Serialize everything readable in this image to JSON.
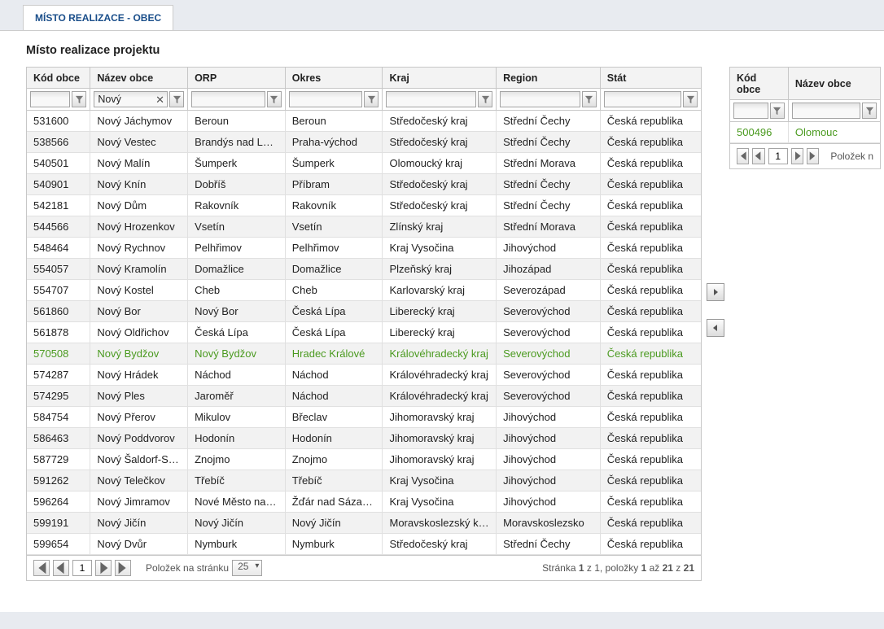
{
  "tab_label": "MÍSTO REALIZACE - OBEC",
  "section_title": "Místo realizace projektu",
  "left_grid": {
    "headers": [
      "Kód obce",
      "Název obce",
      "ORP",
      "Okres",
      "Kraj",
      "Region",
      "Stát"
    ],
    "filter_values": [
      "",
      "Nový",
      "",
      "",
      "",
      "",
      ""
    ],
    "highlight_index": 12,
    "rows": [
      [
        "531600",
        "Nový Jáchymov",
        "Beroun",
        "Beroun",
        "Středočeský kraj",
        "Střední Čechy",
        "Česká republika"
      ],
      [
        "538566",
        "Nový Vestec",
        "Brandýs nad Lab...",
        "Praha-východ",
        "Středočeský kraj",
        "Střední Čechy",
        "Česká republika"
      ],
      [
        "540501",
        "Nový Malín",
        "Šumperk",
        "Šumperk",
        "Olomoucký kraj",
        "Střední Morava",
        "Česká republika"
      ],
      [
        "540901",
        "Nový Knín",
        "Dobříš",
        "Příbram",
        "Středočeský kraj",
        "Střední Čechy",
        "Česká republika"
      ],
      [
        "542181",
        "Nový Dům",
        "Rakovník",
        "Rakovník",
        "Středočeský kraj",
        "Střední Čechy",
        "Česká republika"
      ],
      [
        "544566",
        "Nový Hrozenkov",
        "Vsetín",
        "Vsetín",
        "Zlínský kraj",
        "Střední Morava",
        "Česká republika"
      ],
      [
        "548464",
        "Nový Rychnov",
        "Pelhřimov",
        "Pelhřimov",
        "Kraj Vysočina",
        "Jihovýchod",
        "Česká republika"
      ],
      [
        "554057",
        "Nový Kramolín",
        "Domažlice",
        "Domažlice",
        "Plzeňský kraj",
        "Jihozápad",
        "Česká republika"
      ],
      [
        "554707",
        "Nový Kostel",
        "Cheb",
        "Cheb",
        "Karlovarský kraj",
        "Severozápad",
        "Česká republika"
      ],
      [
        "561860",
        "Nový Bor",
        "Nový Bor",
        "Česká Lípa",
        "Liberecký kraj",
        "Severovýchod",
        "Česká republika"
      ],
      [
        "561878",
        "Nový Oldřichov",
        "Česká Lípa",
        "Česká Lípa",
        "Liberecký kraj",
        "Severovýchod",
        "Česká republika"
      ],
      [
        "570508",
        "Nový Bydžov",
        "Nový Bydžov",
        "Hradec Králové",
        "Královéhradecký kraj",
        "Severovýchod",
        "Česká republika"
      ],
      [
        "574287",
        "Nový Hrádek",
        "Náchod",
        "Náchod",
        "Královéhradecký kraj",
        "Severovýchod",
        "Česká republika"
      ],
      [
        "574295",
        "Nový Ples",
        "Jaroměř",
        "Náchod",
        "Královéhradecký kraj",
        "Severovýchod",
        "Česká republika"
      ],
      [
        "584754",
        "Nový Přerov",
        "Mikulov",
        "Břeclav",
        "Jihomoravský kraj",
        "Jihovýchod",
        "Česká republika"
      ],
      [
        "586463",
        "Nový Poddvorov",
        "Hodonín",
        "Hodonín",
        "Jihomoravský kraj",
        "Jihovýchod",
        "Česká republika"
      ],
      [
        "587729",
        "Nový Šaldorf-Sed...",
        "Znojmo",
        "Znojmo",
        "Jihomoravský kraj",
        "Jihovýchod",
        "Česká republika"
      ],
      [
        "591262",
        "Nový Telečkov",
        "Třebíč",
        "Třebíč",
        "Kraj Vysočina",
        "Jihovýchod",
        "Česká republika"
      ],
      [
        "596264",
        "Nový Jimramov",
        "Nové Město na M...",
        "Žďár nad Sázavou",
        "Kraj Vysočina",
        "Jihovýchod",
        "Česká republika"
      ],
      [
        "599191",
        "Nový Jičín",
        "Nový Jičín",
        "Nový Jičín",
        "Moravskoslezský kraj",
        "Moravskoslezsko",
        "Česká republika"
      ],
      [
        "599654",
        "Nový Dvůr",
        "Nymburk",
        "Nymburk",
        "Středočeský kraj",
        "Střední Čechy",
        "Česká republika"
      ]
    ],
    "pager": {
      "page": "1",
      "per_page_label": "Položek na stránku",
      "per_page_value": "25",
      "info_prefix": "Stránka ",
      "info_page": "1",
      "info_mid1": " z 1, položky ",
      "info_from": "1",
      "info_mid2": " až ",
      "info_to": "21",
      "info_mid3": " z ",
      "info_total": "21"
    }
  },
  "right_grid": {
    "headers": [
      "Kód obce",
      "Název obce"
    ],
    "rows": [
      [
        "500496",
        "Olomouc"
      ]
    ],
    "pager": {
      "page": "1",
      "info_label": "Položek n"
    }
  }
}
